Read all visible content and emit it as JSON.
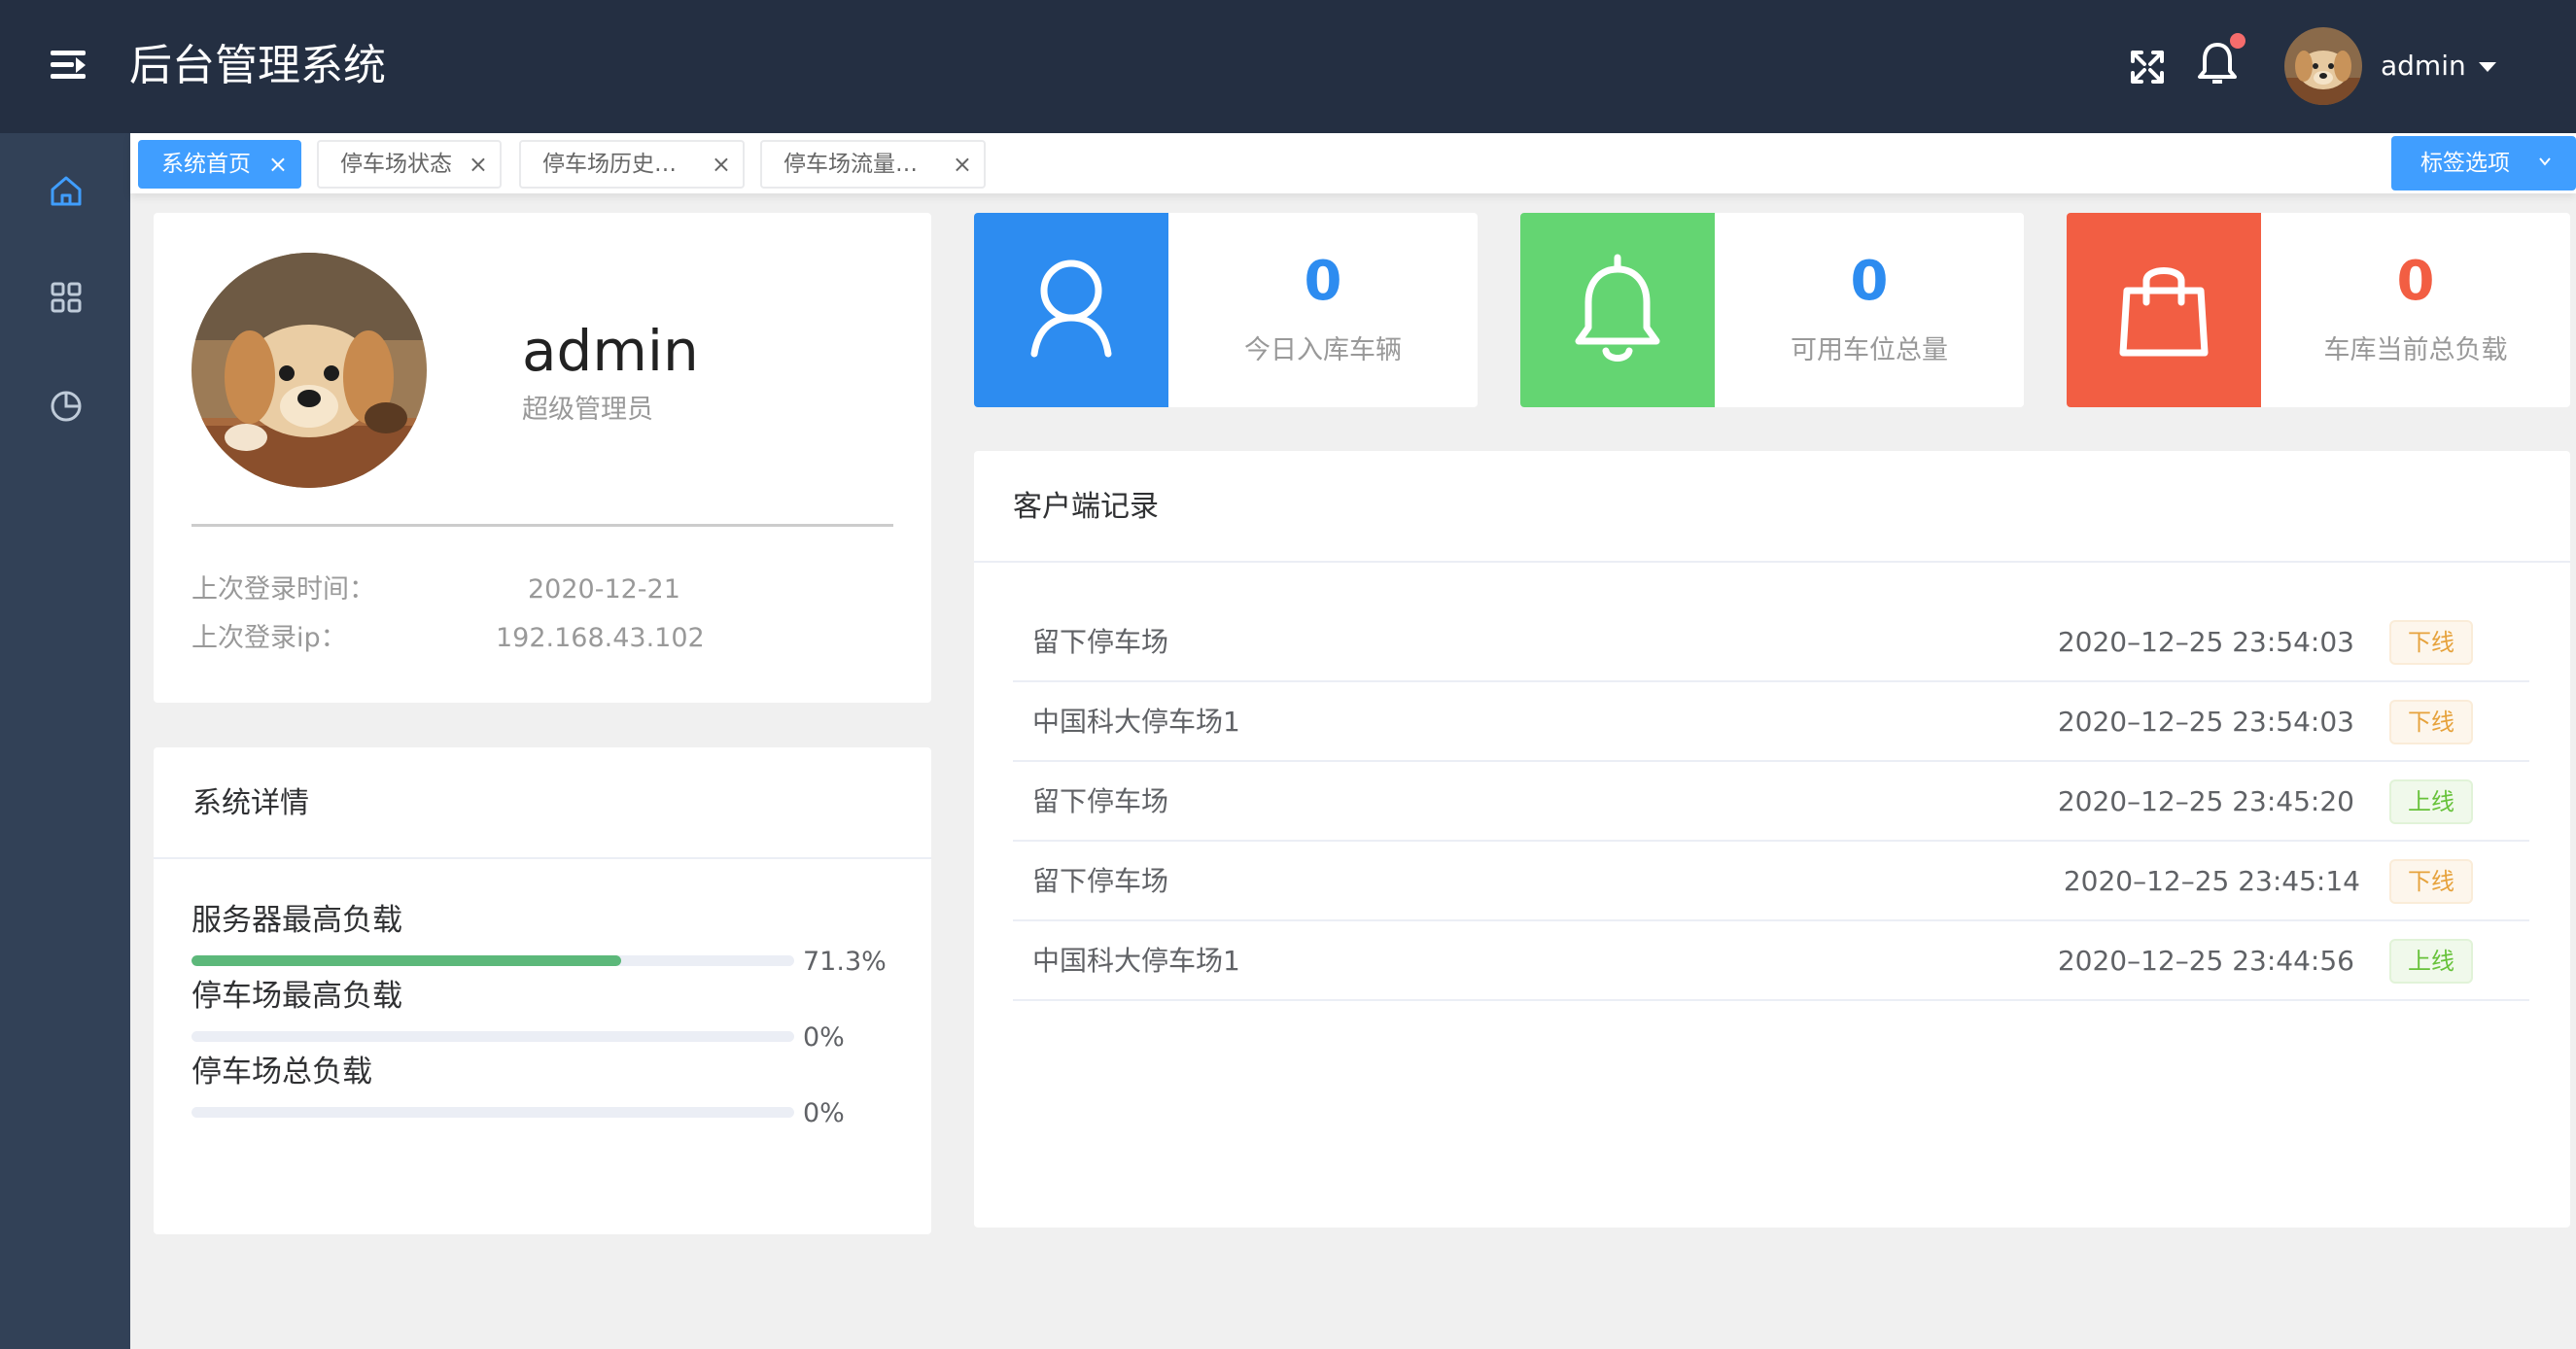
{
  "header": {
    "title": "后台管理系统",
    "username": "admin",
    "notification_dot_color": "#f56c6c",
    "icons": [
      "menu-icon",
      "fullscreen-icon",
      "bell-icon",
      "avatar",
      "caret-down-icon"
    ]
  },
  "sidebar": {
    "items": [
      {
        "icon": "home-icon",
        "active": true
      },
      {
        "icon": "grid-icon",
        "active": false
      },
      {
        "icon": "pie-chart-icon",
        "active": false
      }
    ]
  },
  "tags": {
    "items": [
      {
        "label": "系统首页",
        "active": true
      },
      {
        "label": "停车场状态",
        "active": false
      },
      {
        "label": "停车场历史…",
        "active": false
      },
      {
        "label": "停车场流量…",
        "active": false
      }
    ],
    "close_glyph": "×",
    "options_label": "标签选项"
  },
  "profile": {
    "name": "admin",
    "role": "超级管理员",
    "last_login_time_label": "上次登录时间：",
    "last_login_time": "2020-12-21",
    "last_login_ip_label": "上次登录ip：",
    "last_login_ip": "192.168.43.102"
  },
  "system": {
    "title": "系统详情",
    "items": [
      {
        "label": "服务器最高负载",
        "percent": 71.3,
        "text": "71.3%"
      },
      {
        "label": "停车场最高负载",
        "percent": 0,
        "text": "0%"
      },
      {
        "label": "停车场总负载",
        "percent": 0,
        "text": "0%"
      }
    ],
    "progress_color": "#5cb87a"
  },
  "stats": [
    {
      "value": "0",
      "label": "今日入库车辆",
      "color": "#2d8cf0",
      "icon": "user-icon"
    },
    {
      "value": "0",
      "label": "可用车位总量",
      "color": "#64d572",
      "icon": "bell-icon"
    },
    {
      "value": "0",
      "label": "车库当前总负载",
      "color": "#f25e43",
      "icon": "shopping-bag-icon"
    }
  ],
  "logs": {
    "title": "客户端记录",
    "rows": [
      {
        "name": "留下停车场",
        "time": "2020–12–25 23:54:03",
        "status": "下线",
        "type": "off"
      },
      {
        "name": "中国科大停车场1",
        "time": "2020–12–25 23:54:03",
        "status": "下线",
        "type": "off"
      },
      {
        "name": "留下停车场",
        "time": "2020–12–25 23:45:20",
        "status": "上线",
        "type": "on"
      },
      {
        "name": "留下停车场",
        "time": "2020–12–25 23:45:14",
        "status": "下线",
        "type": "off"
      },
      {
        "name": "中国科大停车场1",
        "time": "2020–12–25 23:44:56",
        "status": "上线",
        "type": "on"
      }
    ]
  }
}
